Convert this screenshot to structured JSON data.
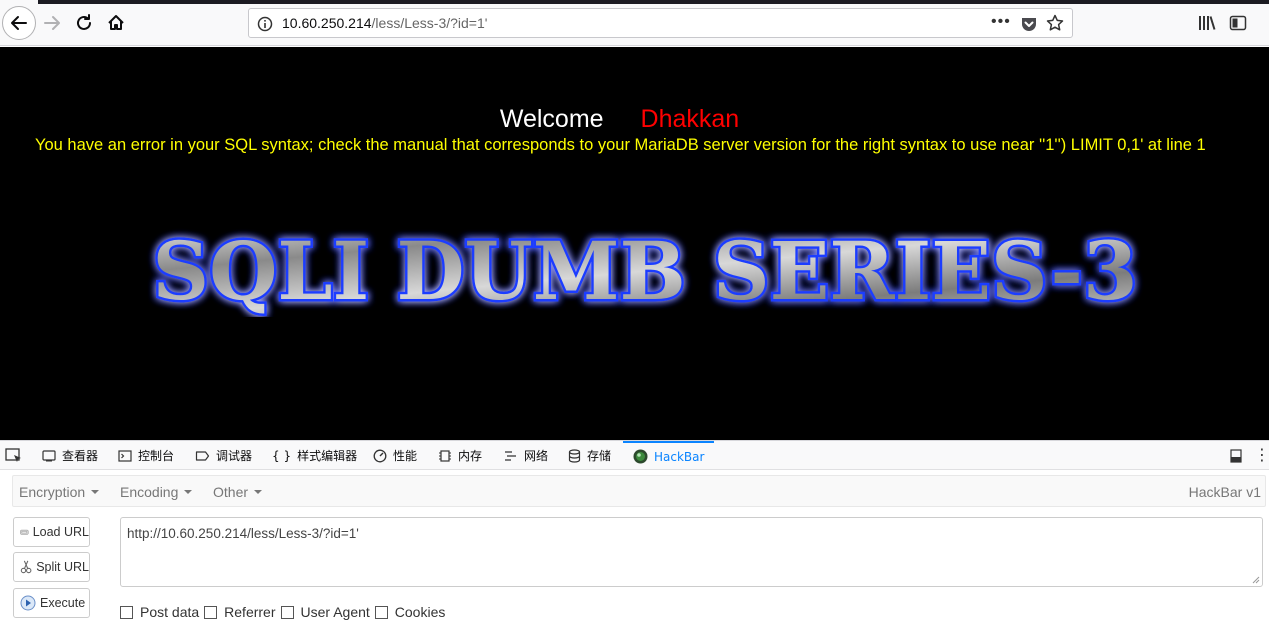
{
  "browser": {
    "url_host": "10.60.250.214",
    "url_path": "/less/Less-3/?id=1'",
    "overflow_menu": "•••",
    "icons": [
      "back-icon",
      "forward-icon",
      "reload-icon",
      "home-icon",
      "info-icon",
      "pocket-icon",
      "bookmark-star-icon",
      "library-icon",
      "sidebar-icon"
    ]
  },
  "page": {
    "welcome_label": "Welcome",
    "welcome_name": "Dhakkan",
    "sql_error": "You have an error in your SQL syntax; check the manual that corresponds to your MariaDB server version for the right syntax to use near ''1'') LIMIT 0,1' at line 1",
    "banner_text": "SQLI DUMB SERIES-3",
    "colors": {
      "background": "#000000",
      "welcome": "#ffffff",
      "name": "#ff0000",
      "error": "#ffff00",
      "banner_glow": "#1a3cff"
    }
  },
  "devtools": {
    "tabs": [
      {
        "label": "查看器",
        "icon": "inspector-icon"
      },
      {
        "label": "控制台",
        "icon": "console-icon"
      },
      {
        "label": "调试器",
        "icon": "debugger-icon"
      },
      {
        "label": "样式编辑器",
        "icon": "style-editor-icon"
      },
      {
        "label": "性能",
        "icon": "performance-icon"
      },
      {
        "label": "内存",
        "icon": "memory-icon"
      },
      {
        "label": "网络",
        "icon": "network-icon"
      },
      {
        "label": "存储",
        "icon": "storage-icon"
      },
      {
        "label": "HackBar",
        "icon": "hackbar-icon",
        "active": true
      }
    ],
    "style_prefix": "{ }",
    "overflow": "⋮",
    "active_color": "#0a84ff"
  },
  "hackbar": {
    "menus": [
      "Encryption",
      "Encoding",
      "Other"
    ],
    "version": "HackBar v1",
    "buttons": [
      "Load URL",
      "Split URL",
      "Execute"
    ],
    "url_value": "http://10.60.250.214/less/Less-3/?id=1'",
    "checkboxes": [
      "Post data",
      "Referrer",
      "User Agent",
      "Cookies"
    ]
  }
}
